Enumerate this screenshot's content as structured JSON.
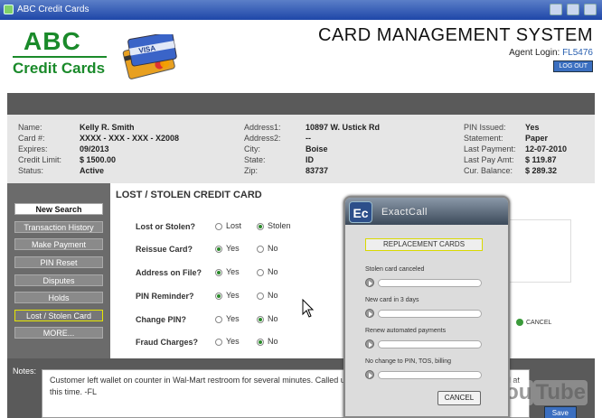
{
  "window": {
    "title": "ABC Credit Cards"
  },
  "brand": {
    "line1": "ABC",
    "line2": "Credit Cards",
    "color": "#1a8a2a",
    "card_brand": "VISA"
  },
  "header": {
    "system_title": "CARD MANAGEMENT SYSTEM",
    "agent_label": "Agent Login:",
    "agent_id": "FL5476",
    "logout_label": "LOG OUT"
  },
  "account": {
    "left": [
      {
        "label": "Name:",
        "value": "Kelly R. Smith"
      },
      {
        "label": "Card #:",
        "value": "XXXX - XXX - XXX - X2008"
      },
      {
        "label": "Expires:",
        "value": "09/2013"
      },
      {
        "label": "Credit Limit:",
        "value": "$ 1500.00"
      },
      {
        "label": "Status:",
        "value": "Active"
      }
    ],
    "mid": [
      {
        "label": "Address1:",
        "value": "10897 W. Ustick Rd"
      },
      {
        "label": "Address2:",
        "value": "--"
      },
      {
        "label": "City:",
        "value": "Boise"
      },
      {
        "label": "State:",
        "value": "ID"
      },
      {
        "label": "Zip:",
        "value": "83737"
      }
    ],
    "right": [
      {
        "label": "PIN Issued:",
        "value": "Yes"
      },
      {
        "label": "Statement:",
        "value": "Paper"
      },
      {
        "label": "Last Payment:",
        "value": "12-07-2010"
      },
      {
        "label": "Last Pay Amt:",
        "value": "$ 119.87"
      },
      {
        "label": "Cur. Balance:",
        "value": "$ 289.32"
      }
    ]
  },
  "sidebar": {
    "items": [
      {
        "label": "New Search"
      },
      {
        "label": "Transaction History"
      },
      {
        "label": "Make Payment"
      },
      {
        "label": "PIN Reset"
      },
      {
        "label": "Disputes"
      },
      {
        "label": "Holds"
      },
      {
        "label": "Lost / Stolen Card"
      },
      {
        "label": "MORE..."
      }
    ]
  },
  "main": {
    "heading": "LOST / STOLEN CREDIT CARD",
    "questions": [
      {
        "label": "Lost or Stolen?",
        "opt1": "Lost",
        "opt2": "Stolen",
        "selected": 2
      },
      {
        "label": "Reissue Card?",
        "opt1": "Yes",
        "opt2": "No",
        "selected": 1
      },
      {
        "label": "Address on File?",
        "opt1": "Yes",
        "opt2": "No",
        "selected": 1
      },
      {
        "label": "PIN Reminder?",
        "opt1": "Yes",
        "opt2": "No",
        "selected": 1
      },
      {
        "label": "Change PIN?",
        "opt1": "Yes",
        "opt2": "No",
        "selected": 2
      },
      {
        "label": "Fraud Charges?",
        "opt1": "Yes",
        "opt2": "No",
        "selected": 2
      }
    ],
    "cancel_label": "CANCEL"
  },
  "notes": {
    "label": "Notes:",
    "text": "Customer left wallet on counter in  Wal-Mart restroom for several minutes. Called us within 10 minutes.  No fraud charges on card at this time.  -FL",
    "save_label": "Save"
  },
  "dialog": {
    "logo_text": "Ec",
    "title": "ExactCall",
    "section": "REPLACEMENT CARDS",
    "items": [
      {
        "label": "Stolen card canceled"
      },
      {
        "label": "New card in 3 days"
      },
      {
        "label": "Renew automated payments"
      },
      {
        "label": "No change to PIN, TOS, billing"
      }
    ],
    "cancel_label": "CANCEL"
  },
  "watermark": {
    "text1": "You",
    "text2": "Tube"
  }
}
